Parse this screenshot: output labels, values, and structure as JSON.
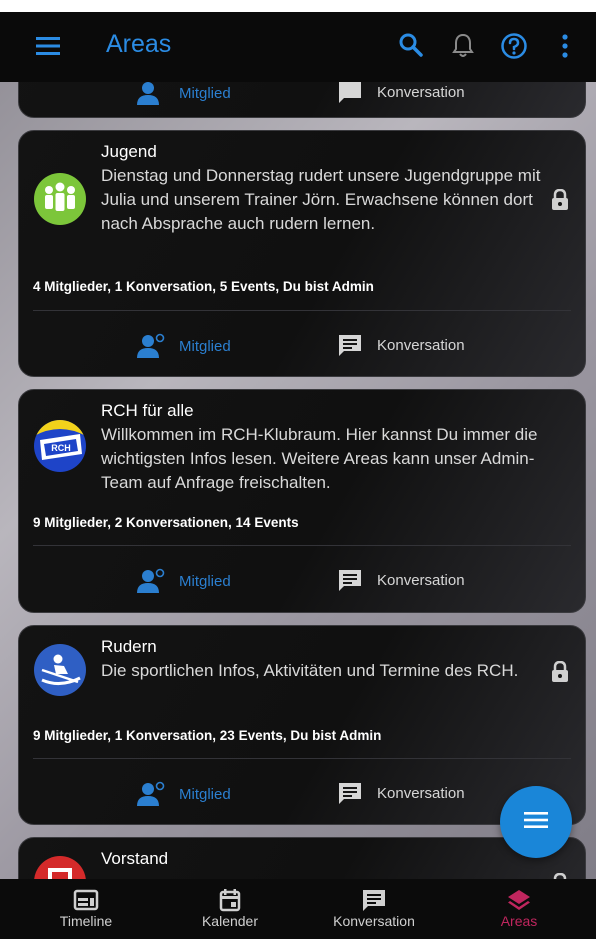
{
  "appbar": {
    "title": "Areas",
    "icons": [
      "menu-icon",
      "search-icon",
      "bell-icon",
      "help-icon",
      "more-vert-icon"
    ]
  },
  "actions": {
    "member_label": "Mitglied",
    "conversation_label": "Konversation"
  },
  "cards": [
    {
      "title": "Jugend",
      "description": "Dienstag und Donnerstag rudert unsere Jugendgruppe mit Julia und unserem Trainer Jörn. Erwachsene können dort nach Absprache auch rudern lernen.",
      "stats": "4 Mitglieder, 1 Konversation, 5 Events, Du bist Admin",
      "locked": true
    },
    {
      "title": "RCH für alle",
      "description": "Willkommen im RCH-Klubraum. Hier kannst Du immer die wichtigsten Infos lesen. Weitere Areas kann unser Admin-Team auf Anfrage freischalten.",
      "stats": "9 Mitglieder, 2 Konversationen, 14 Events",
      "locked": false
    },
    {
      "title": "Rudern",
      "description": "Die sportlichen Infos, Aktivitäten und Termine des RCH.",
      "stats": "9 Mitglieder, 1 Konversation, 23 Events, Du bist Admin",
      "locked": true
    },
    {
      "title": "Vorstand",
      "locked": true
    }
  ],
  "bottom_nav": [
    {
      "label": "Timeline",
      "icon": "timeline-icon"
    },
    {
      "label": "Kalender",
      "icon": "calendar-icon"
    },
    {
      "label": "Konversation",
      "icon": "conversation-icon"
    },
    {
      "label": "Areas",
      "icon": "areas-icon",
      "active": true
    }
  ],
  "colors": {
    "accent_blue": "#2b8ce4",
    "active_nav": "#c0265e",
    "fab": "#1a86d8"
  }
}
